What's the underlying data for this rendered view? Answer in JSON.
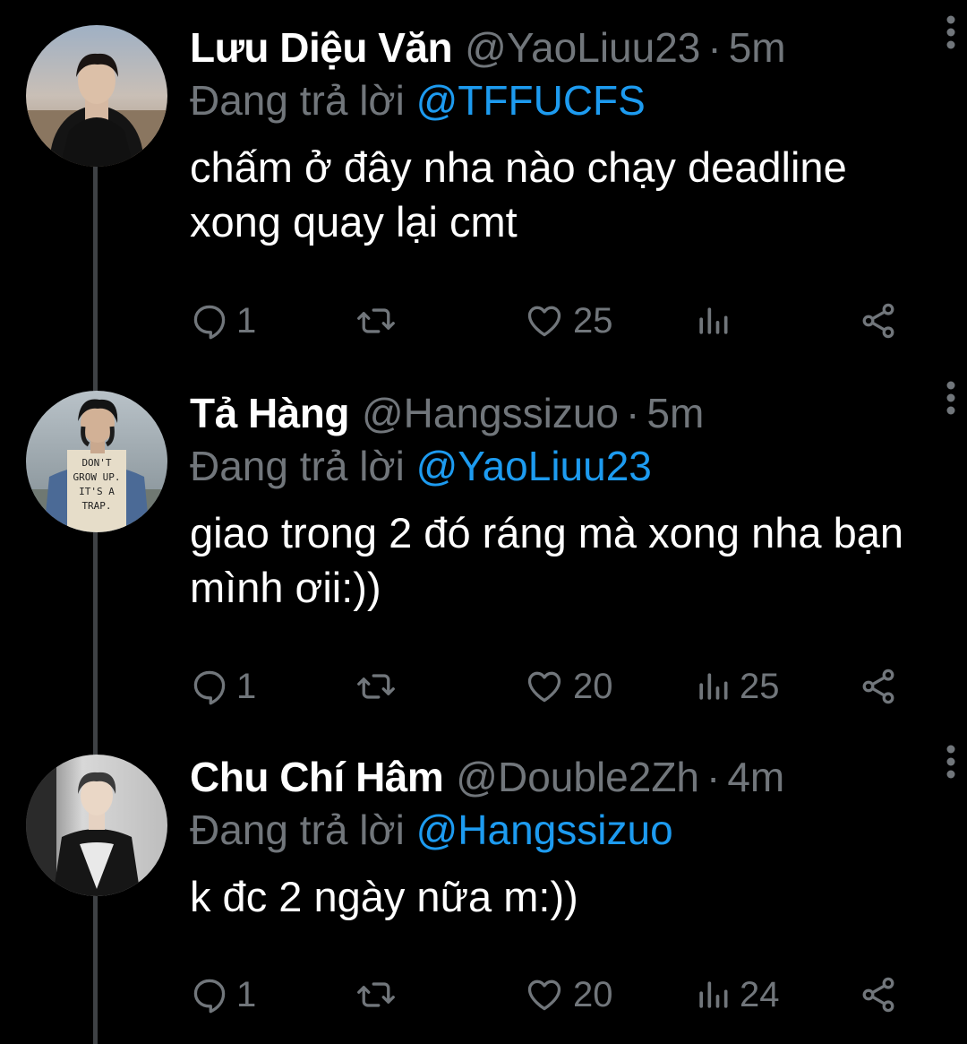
{
  "tweets": [
    {
      "name": "Lưu Diệu Văn",
      "handle": "@YaoLiuu23",
      "separator": "·",
      "time": "5m",
      "reply_prefix": "Đang trả lời",
      "reply_to": "@TFFUCFS",
      "text": "chấm ở đây nha nào chạy deadline xong quay lại cmt",
      "replies": "1",
      "retweets": "",
      "likes": "25",
      "views": "",
      "avatar_icon": "avatar-photo"
    },
    {
      "name": "Tả Hàng",
      "handle": "@Hangssizuo",
      "separator": "·",
      "time": "5m",
      "reply_prefix": "Đang trả lời",
      "reply_to": "@YaoLiuu23",
      "text": "giao trong 2 đó ráng mà xong nha bạn mình ơii:))",
      "replies": "1",
      "retweets": "",
      "likes": "20",
      "views": "25",
      "avatar_icon": "avatar-photo",
      "avatar_shirt_text": "DON'T GROW UP. IT'S A TRAP."
    },
    {
      "name": "Chu Chí Hâm",
      "handle": "@Double2Zh",
      "separator": "·",
      "time": "4m",
      "reply_prefix": "Đang trả lời",
      "reply_to": "@Hangssizuo",
      "text": "k đc 2 ngày nữa m:))",
      "replies": "1",
      "retweets": "",
      "likes": "20",
      "views": "24",
      "avatar_icon": "avatar-photo"
    }
  ],
  "colors": {
    "background": "#000000",
    "primary_text": "#ffffff",
    "secondary_text": "#71767b",
    "mention": "#1d9bf0",
    "thread_line": "#3e4144"
  },
  "icons": [
    "reply-icon",
    "retweet-icon",
    "like-icon",
    "views-icon",
    "share-icon",
    "more-icon"
  ]
}
